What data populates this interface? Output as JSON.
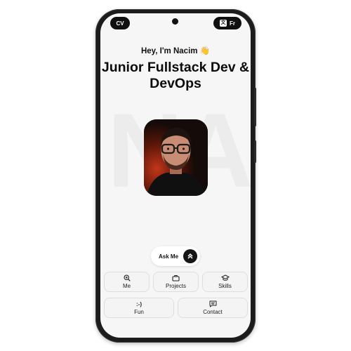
{
  "header": {
    "cv_label": "CV",
    "lang_label": "Fr",
    "lang_glyph": "文"
  },
  "hero": {
    "background_text": "NA",
    "greeting": "Hey, I'm Nacim 👋",
    "title": "Junior Fullstack Dev & DevOps"
  },
  "avatar": {
    "icon": "profile-photo"
  },
  "ask": {
    "label": "Ask Me",
    "icon": "chevrons-up-icon"
  },
  "nav": {
    "me": {
      "label": "Me",
      "icon": "zoom-in-icon"
    },
    "projects": {
      "label": "Projects",
      "icon": "briefcase-icon"
    },
    "skills": {
      "label": "Skills",
      "icon": "graduation-cap-icon"
    },
    "fun": {
      "label": "Fun",
      "glyph": ":-)"
    },
    "contact": {
      "label": "Contact",
      "icon": "message-square-icon"
    }
  },
  "colors": {
    "accent": "#111111",
    "screen_bg": "#f6f6f6",
    "tile_border": "#dedede"
  }
}
